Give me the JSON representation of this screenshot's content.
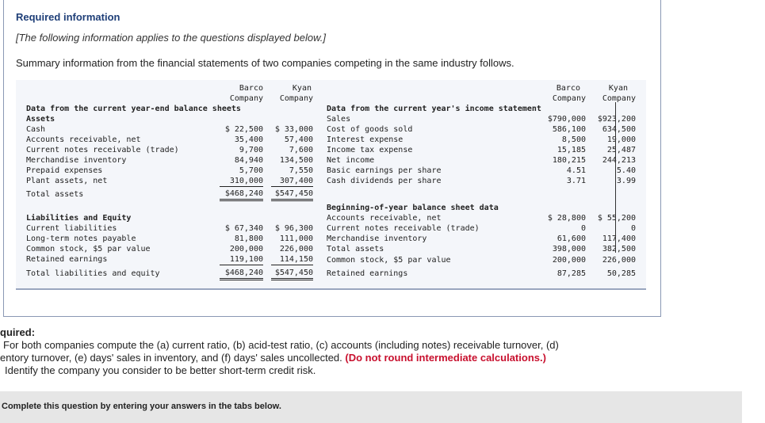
{
  "header": {
    "title": "Required information",
    "note": "[The following information applies to the questions displayed below.]",
    "summary": "Summary information from the financial statements of two companies competing in the same industry follows."
  },
  "columns": {
    "barco_l1": "Barco",
    "barco_l2": "Company",
    "kyan_l1": "Kyan",
    "kyan_l2": "Company"
  },
  "left": {
    "section_title": "Data from the current year-end balance sheets",
    "assets_heading": "Assets",
    "assets": [
      {
        "label": "Cash",
        "barco": "$ 22,500",
        "kyan": "$ 33,000"
      },
      {
        "label": "Accounts receivable, net",
        "barco": "35,400",
        "kyan": "57,400"
      },
      {
        "label": "Current notes receivable (trade)",
        "barco": "9,700",
        "kyan": "7,600"
      },
      {
        "label": "Merchandise inventory",
        "barco": "84,940",
        "kyan": "134,500"
      },
      {
        "label": "Prepaid expenses",
        "barco": "5,700",
        "kyan": "7,550"
      },
      {
        "label": "Plant assets, net",
        "barco": "310,000",
        "kyan": "307,400"
      }
    ],
    "total_assets": {
      "label": "Total assets",
      "barco": "$468,240",
      "kyan": "$547,450"
    },
    "liab_heading": "Liabilities and Equity",
    "liabilities": [
      {
        "label": "Current liabilities",
        "barco": "$ 67,340",
        "kyan": "$ 96,300"
      },
      {
        "label": "Long-term notes payable",
        "barco": "81,800",
        "kyan": "111,000"
      },
      {
        "label": "Common stock, $5 par value",
        "barco": "200,000",
        "kyan": "226,000"
      },
      {
        "label": "Retained earnings",
        "barco": "119,100",
        "kyan": "114,150"
      }
    ],
    "total_liab": {
      "label": "Total liabilities and equity",
      "barco": "$468,240",
      "kyan": "$547,450"
    }
  },
  "right": {
    "income_title": "Data from the current year's income statement",
    "income": [
      {
        "label": "Sales",
        "barco": "$790,000",
        "kyan": "$923,200"
      },
      {
        "label": "Cost of goods sold",
        "barco": "586,100",
        "kyan": "634,500"
      },
      {
        "label": "Interest expense",
        "barco": "8,500",
        "kyan": "19,000"
      },
      {
        "label": "Income tax expense",
        "barco": "15,185",
        "kyan": "25,487"
      },
      {
        "label": "Net income",
        "barco": "180,215",
        "kyan": "244,213"
      },
      {
        "label": "Basic earnings per share",
        "barco": "4.51",
        "kyan": "5.40"
      },
      {
        "label": "Cash dividends per share",
        "barco": "3.71",
        "kyan": "3.99"
      }
    ],
    "beginning_title": "Beginning-of-year balance sheet data",
    "beginning": [
      {
        "label": "Accounts receivable, net",
        "barco": "$ 28,800",
        "kyan": "$ 55,200"
      },
      {
        "label": "Current notes receivable (trade)",
        "barco": "0",
        "kyan": "0"
      },
      {
        "label": "Merchandise inventory",
        "barco": "61,600",
        "kyan": "117,400"
      },
      {
        "label": "Total assets",
        "barco": "398,000",
        "kyan": "382,500"
      },
      {
        "label": "Common stock, $5 par value",
        "barco": "200,000",
        "kyan": "226,000"
      },
      {
        "label": "Retained earnings",
        "barco": "87,285",
        "kyan": "50,285"
      }
    ]
  },
  "required": {
    "heading": "quired:",
    "line1": "For both companies compute the (a) current ratio, (b) acid-test ratio, (c) accounts (including notes) receivable turnover, (d)",
    "line2_start": "entory turnover, (e) days' sales in inventory, and (f) days' sales uncollected.",
    "line2_red": "(Do not round intermediate calculations.)",
    "line3": "Identify the company you consider to be better short-term credit risk."
  },
  "banner": {
    "text": "Complete this question by entering your answers in the tabs below."
  }
}
